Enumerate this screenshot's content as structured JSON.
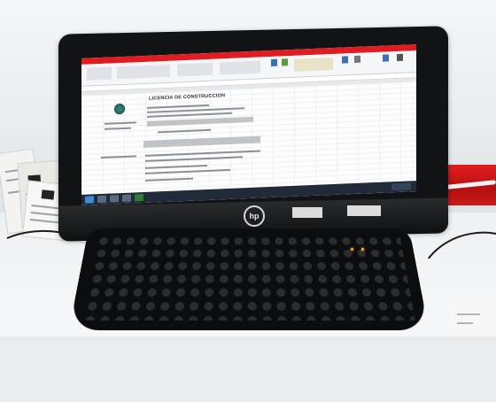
{
  "photo": {
    "description_hidden": "",
    "screen": {
      "document_title": "LICENCIA DE CONSTRUCCION"
    },
    "monitor_brand": "hp",
    "colors": {
      "ribbon_red": "#e01b22",
      "can_red": "#c81a1a",
      "pen_orange": "#f36a28"
    }
  }
}
